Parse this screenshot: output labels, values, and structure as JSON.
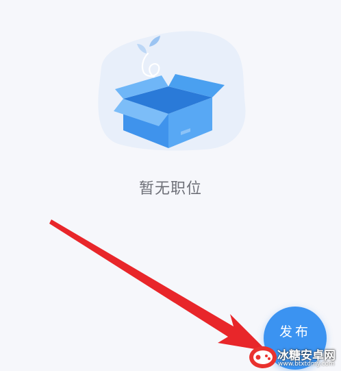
{
  "empty_state": {
    "illustration_icon": "empty-box-icon",
    "message": "暂无职位"
  },
  "fab": {
    "label": "发布",
    "color": "#3b93f1"
  },
  "annotation": {
    "arrow_color": "#e8262a"
  },
  "watermark": {
    "title": "冰糖安卓网",
    "url": "www.btxtdmy.com"
  }
}
